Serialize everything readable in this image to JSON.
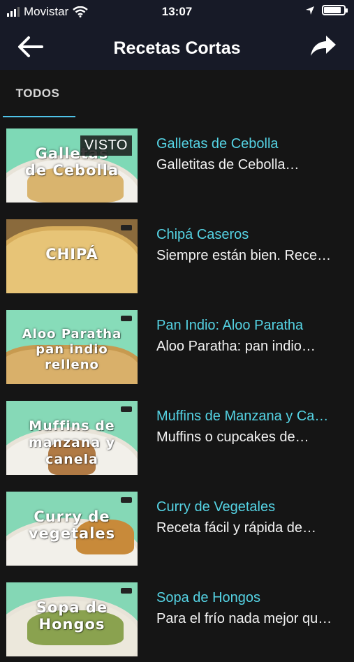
{
  "status": {
    "carrier": "Movistar",
    "time": "13:07",
    "battery_level": 0.85
  },
  "nav": {
    "title": "Recetas Cortas",
    "back_icon": "arrow-left-icon",
    "share_icon": "share-arrow-icon"
  },
  "tabs": [
    {
      "label": "TODOS",
      "selected": true
    }
  ],
  "colors": {
    "accent": "#4fc3e8",
    "title": "#55d3e4",
    "bar": "#171a27",
    "background": "#151515"
  },
  "items": [
    {
      "thumb_text": "Galletas\nde Cebolla",
      "watched_label": "VISTO",
      "title": "Galletas de Cebolla",
      "subtitle": "Galletitas de Cebolla…"
    },
    {
      "thumb_text": "CHIPÁ",
      "title": "Chipá Caseros",
      "subtitle": "Siempre están bien. Rece…"
    },
    {
      "thumb_text": "Aloo Paratha\npan indio relleno",
      "title": "Pan Indio: Aloo Paratha",
      "subtitle": "Aloo Paratha: pan indio…"
    },
    {
      "thumb_text": "Muffins de\nmanzana y canela",
      "title": "Muffins de Manzana y Ca…",
      "subtitle": "Muffins o cupcakes de…"
    },
    {
      "thumb_text": "Curry de\nvegetales",
      "title": "Curry de Vegetales",
      "subtitle": "Receta fácil y rápida de…"
    },
    {
      "thumb_text": "Sopa de\nHongos",
      "title": "Sopa de Hongos",
      "subtitle": "Para el frío nada mejor qu…"
    }
  ]
}
